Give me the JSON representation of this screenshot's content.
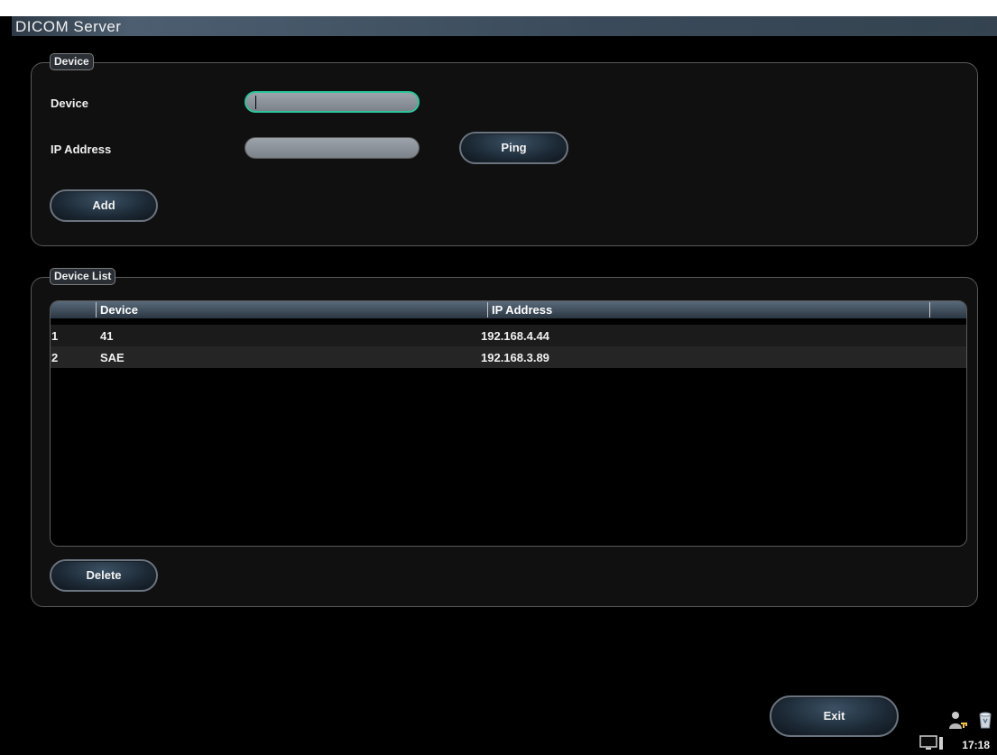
{
  "window": {
    "title": "DICOM Server"
  },
  "device_panel": {
    "legend": "Device",
    "device_label": "Device",
    "device_value": "",
    "ip_label": "IP Address",
    "ip_value": "",
    "ping_button": "Ping",
    "add_button": "Add"
  },
  "list_panel": {
    "legend": "Device List",
    "columns": [
      "Device",
      "IP Address"
    ],
    "rows": [
      {
        "index": "1",
        "device": "41",
        "ip": "192.168.4.44"
      },
      {
        "index": "2",
        "device": "SAE",
        "ip": "192.168.3.89"
      }
    ],
    "delete_button": "Delete"
  },
  "footer": {
    "exit_button": "Exit",
    "time": "17:18"
  },
  "colors": {
    "focus_border": "#2cc59a",
    "titlebar": "#4c5e70",
    "background": "#000000"
  },
  "icons": [
    "user-key-icon",
    "recycle-bin-icon",
    "monitor-icon"
  ]
}
